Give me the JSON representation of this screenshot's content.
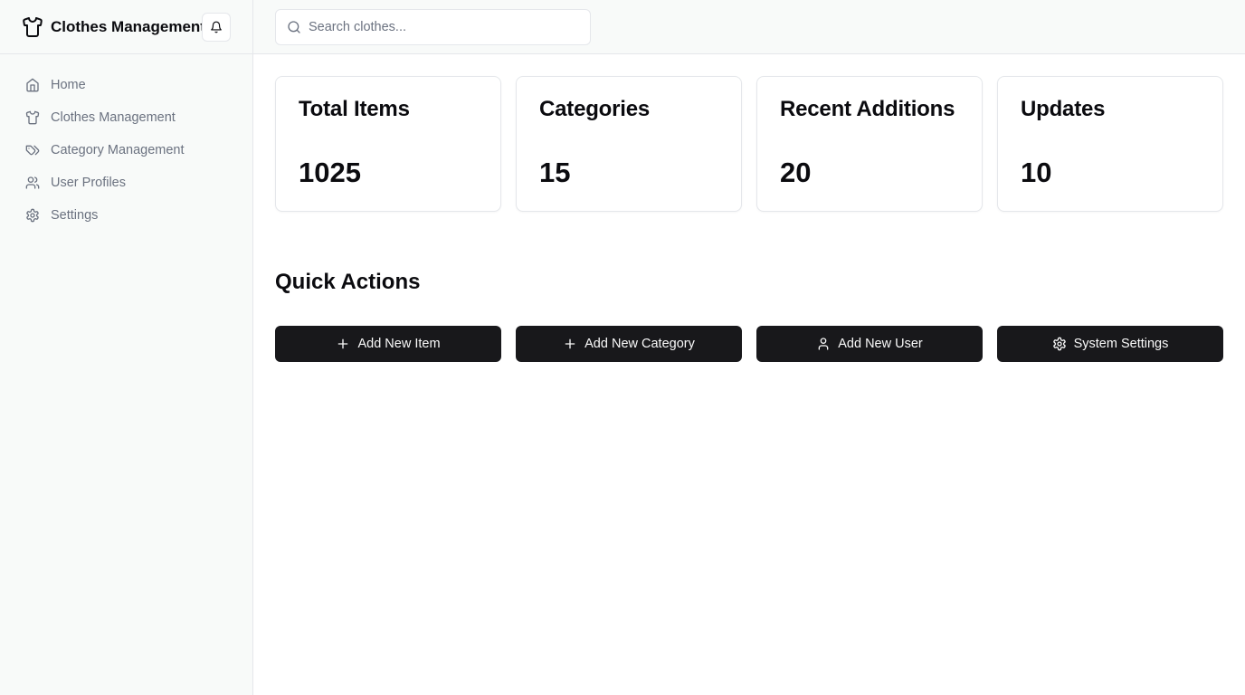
{
  "brand": {
    "title": "Clothes Management",
    "icon": "shirt-icon"
  },
  "header": {
    "notifications_icon": "bell-icon"
  },
  "search": {
    "placeholder": "Search clothes...",
    "value": "",
    "icon": "search-icon"
  },
  "sidebar": {
    "items": [
      {
        "label": "Home",
        "icon": "home-icon"
      },
      {
        "label": "Clothes Management",
        "icon": "shirt-icon"
      },
      {
        "label": "Category Management",
        "icon": "tags-icon"
      },
      {
        "label": "User Profiles",
        "icon": "users-icon"
      },
      {
        "label": "Settings",
        "icon": "gear-icon"
      }
    ]
  },
  "stats": [
    {
      "title": "Total Items",
      "value": "1025"
    },
    {
      "title": "Categories",
      "value": "15"
    },
    {
      "title": "Recent Additions",
      "value": "20"
    },
    {
      "title": "Updates",
      "value": "10"
    }
  ],
  "quick_actions": {
    "title": "Quick Actions",
    "buttons": [
      {
        "label": "Add New Item",
        "icon": "plus-icon"
      },
      {
        "label": "Add New Category",
        "icon": "plus-icon"
      },
      {
        "label": "Add New User",
        "icon": "user-icon"
      },
      {
        "label": "System Settings",
        "icon": "gear-icon"
      }
    ]
  },
  "colors": {
    "sidebar_bg": "#f8faf9",
    "border": "#e5e7eb",
    "button_bg": "#18181b",
    "button_text": "#fafafa",
    "muted_text": "#6b7280",
    "text": "#0b0b0f"
  }
}
